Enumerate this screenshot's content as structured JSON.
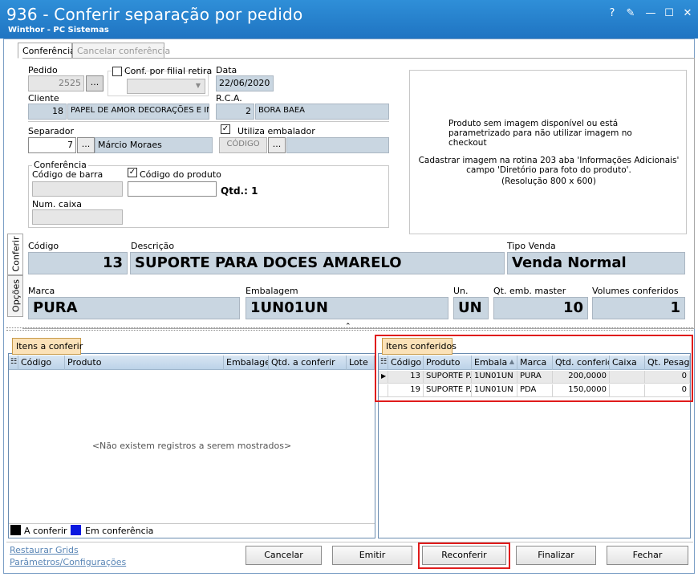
{
  "window": {
    "title": "936 - Conferir separação por pedido",
    "subtitle": "Winthor - PC Sistemas",
    "controls": {
      "help": "?",
      "edit": "✎",
      "minimize": "—",
      "maximize": "☐",
      "close": "✕"
    }
  },
  "tabs": {
    "conferencia": "Conferência",
    "cancelar": "Cancelar conferência"
  },
  "side_tabs": {
    "conferir": "Conferir",
    "opcoes": "Opções"
  },
  "form": {
    "pedido": {
      "label": "Pedido",
      "value": "2525"
    },
    "conf_filial": {
      "label": "Conf. por filial retira",
      "checked": false
    },
    "data": {
      "label": "Data",
      "value": "22/06/2020"
    },
    "cliente": {
      "label": "Cliente",
      "code": "18",
      "name": "PAPEL DE AMOR DECORAÇÕES E IN"
    },
    "rca": {
      "label": "R.C.A.",
      "code": "2",
      "name": "BORA BAEA"
    },
    "separador": {
      "label": "Separador",
      "code": "7",
      "name": "Márcio Moraes"
    },
    "utiliza_embalador": {
      "label": "Utiliza embalador",
      "checked": true,
      "code_placeholder": "CÓDIGO"
    },
    "conferencia_group": {
      "label": "Conferência"
    },
    "codigo_barra": {
      "label": "Código de barra",
      "value": ""
    },
    "codigo_produto": {
      "label": "Código do produto",
      "checked": true,
      "value": ""
    },
    "qtd": {
      "label": "Qtd.: 1"
    },
    "num_caixa": {
      "label": "Num. caixa",
      "value": ""
    },
    "dots": "..."
  },
  "image_box": {
    "line1": "Produto sem imagem disponível ou está parametrizado para não utilizar imagem no checkout",
    "line2": "Cadastrar imagem na rotina 203 aba 'Informações Adicionais' campo 'Diretório para foto do produto'.",
    "line3": "(Resolução 800 x 600)"
  },
  "product": {
    "codigo": {
      "label": "Código",
      "value": "13"
    },
    "descricao": {
      "label": "Descrição",
      "value": "SUPORTE PARA DOCES AMARELO"
    },
    "tipo_venda": {
      "label": "Tipo Venda",
      "value": "Venda Normal"
    },
    "marca": {
      "label": "Marca",
      "value": "PURA"
    },
    "embalagem": {
      "label": "Embalagem",
      "value": "1UN01UN"
    },
    "un": {
      "label": "Un.",
      "value": "UN"
    },
    "qt_emb_master": {
      "label": "Qt. emb. master",
      "value": "10"
    },
    "volumes": {
      "label": "Volumes conferidos",
      "value": "1"
    }
  },
  "grid_left": {
    "tab": "Itens a conferir",
    "columns": [
      "Código",
      "Produto",
      "Embalagem",
      "Qtd. a conferir",
      "Lote"
    ],
    "empty": "<Não existem registros a serem mostrados>",
    "legend": [
      {
        "label": "A conferir",
        "color": "#000000"
      },
      {
        "label": "Em conferência",
        "color": "#0a18e0"
      }
    ]
  },
  "grid_right": {
    "tab": "Itens conferidos",
    "columns": [
      "Código",
      "Produto",
      "Embala",
      "Marca",
      "Qtd. conferid",
      "Caixa",
      "Qt. Pesage"
    ],
    "rows": [
      {
        "codigo": "13",
        "produto": "SUPORTE P...",
        "embala": "1UN01UN",
        "marca": "PURA",
        "qtd": "200,0000",
        "caixa": "",
        "pesagem": "0"
      },
      {
        "codigo": "19",
        "produto": "SUPORTE P...",
        "embala": "1UN01UN",
        "marca": "PDA",
        "qtd": "150,0000",
        "caixa": "",
        "pesagem": "0"
      }
    ]
  },
  "footer": {
    "links": [
      "Restaurar Grids",
      "Parâmetros/Configurações"
    ],
    "buttons": {
      "cancelar": "Cancelar",
      "emitir": "Emitir",
      "reconferir": "Reconferir",
      "finalizar": "Finalizar",
      "fechar": "Fechar"
    }
  },
  "colors": {
    "titlebar": "#1f74c2",
    "readonly_field": "#c9d6e1",
    "highlight": "#e01c1c",
    "grid_tab": "#fbe2b8"
  }
}
